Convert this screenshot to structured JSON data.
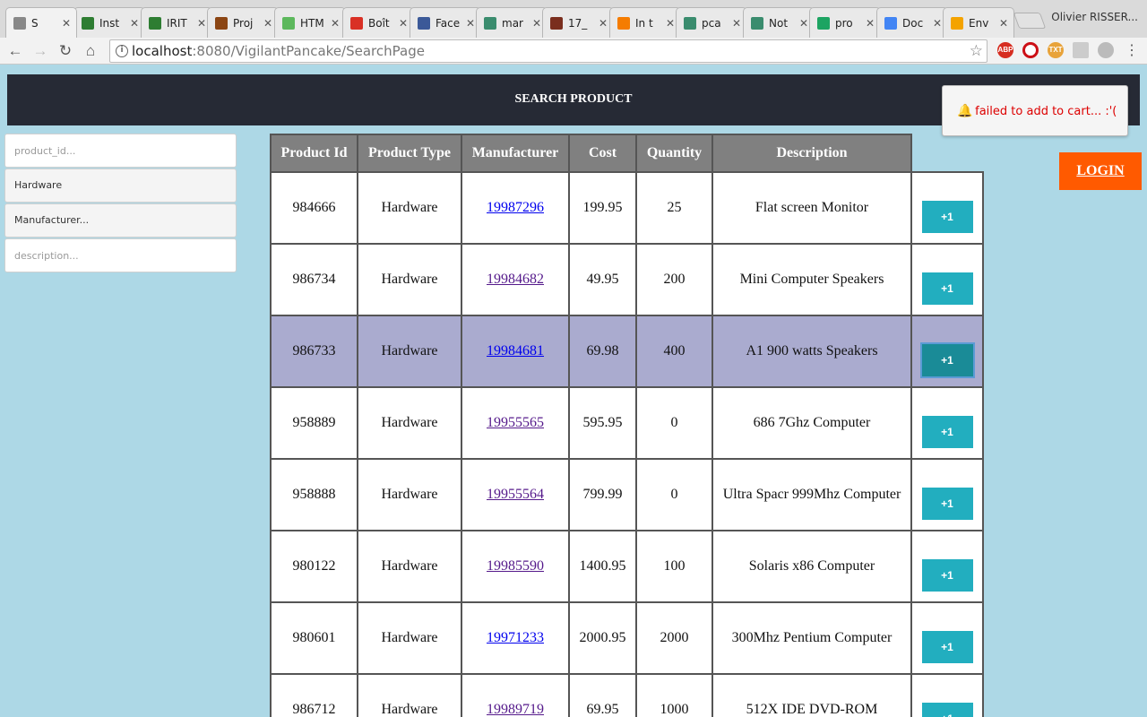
{
  "browser": {
    "tabs": [
      {
        "label": "S",
        "icon": "page-icon",
        "color": "#888888",
        "active": true
      },
      {
        "label": "Inst",
        "icon": "tool-icon",
        "color": "#2e7d32"
      },
      {
        "label": "IRIT",
        "icon": "tool-icon",
        "color": "#2e7d32"
      },
      {
        "label": "Proj",
        "icon": "gnu-icon",
        "color": "#8b4513"
      },
      {
        "label": "HTM",
        "icon": "w3-icon",
        "color": "#5cb85c"
      },
      {
        "label": "Boît",
        "icon": "gmail-icon",
        "color": "#d93025"
      },
      {
        "label": "Face",
        "icon": "facebook-icon",
        "color": "#3b5998"
      },
      {
        "label": "mar",
        "icon": "sheet-icon",
        "color": "#3a8c6e"
      },
      {
        "label": "17_",
        "icon": "image-icon",
        "color": "#7a2e1e"
      },
      {
        "label": "In t",
        "icon": "blogger-icon",
        "color": "#f57c00"
      },
      {
        "label": "pca",
        "icon": "sheet-icon",
        "color": "#3a8c6e"
      },
      {
        "label": "Not",
        "icon": "sheet-icon",
        "color": "#3a8c6e"
      },
      {
        "label": "pro",
        "icon": "drive-icon",
        "color": "#1da462"
      },
      {
        "label": "Doc",
        "icon": "docs-icon",
        "color": "#4285f4"
      },
      {
        "label": "Env",
        "icon": "pencil-icon",
        "color": "#f4a300"
      }
    ],
    "profile_name": "Olivier RISSER...",
    "url_host": "localhost",
    "url_path": ":8080/VigilantPancake/SearchPage"
  },
  "header": {
    "title": "SEARCH PRODUCT"
  },
  "filters": {
    "product_id_placeholder": "product_id...",
    "type_value": "Hardware",
    "manufacturer_value": "Manufacturer...",
    "description_placeholder": "description..."
  },
  "table": {
    "headers": [
      "Product Id",
      "Product Type",
      "Manufacturer",
      "Cost",
      "Quantity",
      "Description"
    ],
    "add_label": "+1",
    "rows": [
      {
        "id": "984666",
        "type": "Hardware",
        "manufacturer": "19987296",
        "cost": "199.95",
        "quantity": "25",
        "description": "Flat screen Monitor"
      },
      {
        "id": "986734",
        "type": "Hardware",
        "manufacturer": "19984682",
        "cost": "49.95",
        "quantity": "200",
        "description": "Mini Computer Speakers"
      },
      {
        "id": "986733",
        "type": "Hardware",
        "manufacturer": "19984681",
        "cost": "69.98",
        "quantity": "400",
        "description": "A1 900 watts Speakers"
      },
      {
        "id": "958889",
        "type": "Hardware",
        "manufacturer": "19955565",
        "cost": "595.95",
        "quantity": "0",
        "description": "686 7Ghz Computer"
      },
      {
        "id": "958888",
        "type": "Hardware",
        "manufacturer": "19955564",
        "cost": "799.99",
        "quantity": "0",
        "description": "Ultra Spacr 999Mhz Computer"
      },
      {
        "id": "980122",
        "type": "Hardware",
        "manufacturer": "19985590",
        "cost": "1400.95",
        "quantity": "100",
        "description": "Solaris x86 Computer"
      },
      {
        "id": "980601",
        "type": "Hardware",
        "manufacturer": "19971233",
        "cost": "2000.95",
        "quantity": "2000",
        "description": "300Mhz Pentium Computer"
      },
      {
        "id": "986712",
        "type": "Hardware",
        "manufacturer": "19989719",
        "cost": "69.95",
        "quantity": "1000",
        "description": "512X IDE DVD-ROM"
      }
    ]
  },
  "toast": {
    "message": "failed to add to cart... :'("
  },
  "login": {
    "label": "LOGIN"
  },
  "colors": {
    "header_bg": "#262a35",
    "page_bg": "#add8e6",
    "accent_button": "#22aebf",
    "login_bg": "#ff5a00",
    "highlight_row": "#aaabcf",
    "error_text": "#dd0000"
  }
}
